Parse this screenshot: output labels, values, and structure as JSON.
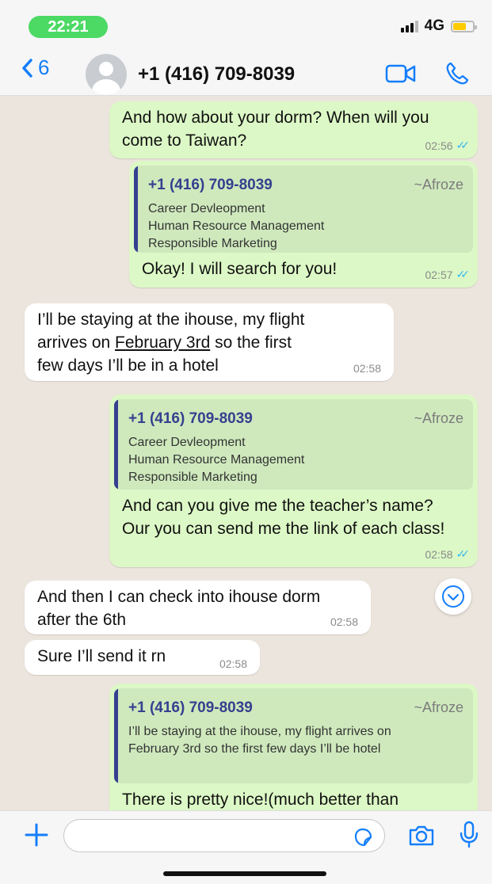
{
  "status_bar": {
    "time": "22:21",
    "network": "4G"
  },
  "header": {
    "back_count": "6",
    "contact": "+1 (416) 709-8039"
  },
  "messages": {
    "m1": {
      "text": "And how about your dorm? When will you come to Taiwan?",
      "time": "02:56"
    },
    "m2": {
      "quote": {
        "name": "+1 (416) 709-8039",
        "tag": "~Afroze",
        "lines": [
          "Career Devleopment",
          "Human Resource Management",
          "Responsible Marketing"
        ]
      },
      "text": "Okay! I will search for you!",
      "time": "02:57"
    },
    "m3": {
      "line1": "I’ll be staying at the ihouse, my flight",
      "line2a": "arrives on ",
      "line2link": "February 3rd",
      "line2b": " so the first",
      "line3": "few days I’ll be in a hotel",
      "time": "02:58"
    },
    "m4": {
      "quote": {
        "name": "+1 (416) 709-8039",
        "tag": "~Afroze",
        "lines": [
          "Career Devleopment",
          "Human Resource Management",
          "Responsible Marketing"
        ]
      },
      "text": "And can you give me the teacher’s name? Our you can send me the link of each class!",
      "time": "02:58"
    },
    "m5": {
      "text": "And then I can check into ihouse dorm after the 6th",
      "time": "02:58"
    },
    "m6": {
      "text": "Sure I’ll send it rn",
      "time": "02:58"
    },
    "m7": {
      "quote": {
        "name": "+1 (416) 709-8039",
        "tag": "~Afroze",
        "body": "I’ll be staying at the ihouse, my flight arrives on February 3rd so the first few days I’ll be hotel"
      },
      "text": "There is pretty nice!(much better than"
    }
  },
  "icons": {
    "back": "chevron-left-icon",
    "video": "video-camera-icon",
    "phone": "phone-icon",
    "plus": "plus-icon",
    "sticker": "sticker-icon",
    "camera": "camera-icon",
    "mic": "microphone-icon",
    "scroll": "chevron-down-icon"
  },
  "colors": {
    "accent": "#147efb",
    "outgoing": "#dcf8c6",
    "incoming": "#ffffff",
    "quote_name": "#35408f",
    "time_pill": "#4cd964"
  }
}
